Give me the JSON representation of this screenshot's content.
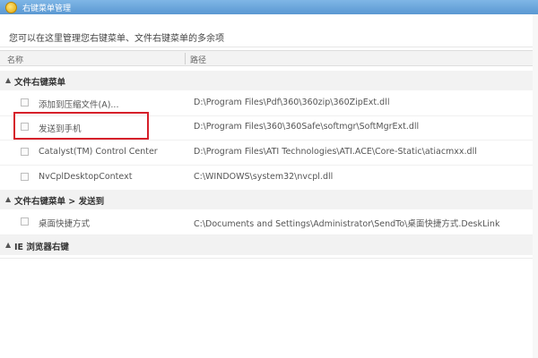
{
  "window": {
    "title": "右键菜单管理"
  },
  "description": "您可以在这里管理您右键菜单、文件右键菜单的多余项",
  "columns": {
    "name": "名称",
    "path": "路径"
  },
  "groups": [
    {
      "label": "文件右键菜单",
      "items": [
        {
          "name": "添加到压缩文件(A)...",
          "path": "D:\\Program Files\\Pdf\\360\\360zip\\360ZipExt.dll"
        },
        {
          "name": "发送到手机",
          "path": "D:\\Program Files\\360\\360Safe\\softmgr\\SoftMgrExt.dll"
        },
        {
          "name": "Catalyst(TM) Control Center",
          "path": "D:\\Program Files\\ATI Technologies\\ATI.ACE\\Core-Static\\atiacmxx.dll"
        },
        {
          "name": "NvCplDesktopContext",
          "path": "C:\\WINDOWS\\system32\\nvcpl.dll"
        }
      ]
    },
    {
      "label": "文件右键菜单 > 发送到",
      "items": [
        {
          "name": "桌面快捷方式",
          "path": "C:\\Documents and Settings\\Administrator\\SendTo\\桌面快捷方式.DeskLink"
        }
      ]
    },
    {
      "label": "IE 浏览器右键",
      "items": []
    }
  ],
  "colors": {
    "titlebar": "#5a98d2",
    "highlight_border": "#d6202a"
  },
  "icons": {
    "app": "app-icon",
    "expand": "triangle-down-icon"
  }
}
